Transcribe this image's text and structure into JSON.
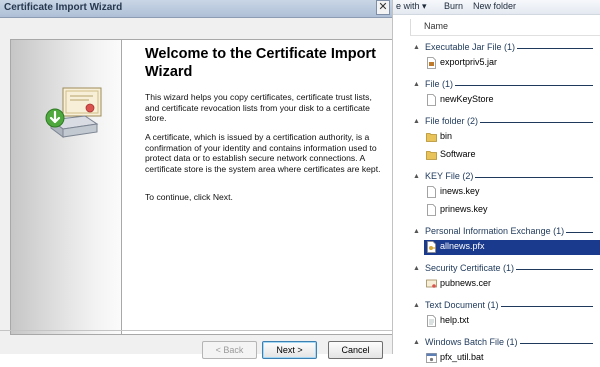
{
  "wizard": {
    "title": "Certificate Import Wizard",
    "close_glyph": "✕",
    "heading": "Welcome to the Certificate Import Wizard",
    "paragraph1": "This wizard helps you copy certificates, certificate trust lists, and certificate revocation lists from your disk to a certificate store.",
    "paragraph2": "A certificate, which is issued by a certification authority, is a confirmation of your identity and contains information used to protect data or to establish secure network connections. A certificate store is the system area where certificates are kept.",
    "paragraph3": "To continue, click Next.",
    "buttons": {
      "back": "< Back",
      "next": "Next >",
      "cancel": "Cancel"
    },
    "side_icon": "certificate-import-icon"
  },
  "explorer": {
    "toolbar": {
      "share": "e with",
      "share_arrow": "▾",
      "burn": "Burn",
      "new_folder": "New folder"
    },
    "column_name": "Name",
    "groups": [
      {
        "label": "Executable Jar File (1)",
        "items": [
          {
            "name": "exportpriv5.jar",
            "icon": "jar-file-icon"
          }
        ]
      },
      {
        "label": "File (1)",
        "items": [
          {
            "name": "newKeyStore",
            "icon": "file-icon"
          }
        ]
      },
      {
        "label": "File folder (2)",
        "items": [
          {
            "name": "bin",
            "icon": "folder-icon"
          },
          {
            "name": "Software",
            "icon": "folder-icon"
          }
        ]
      },
      {
        "label": "KEY File (2)",
        "items": [
          {
            "name": "inews.key",
            "icon": "file-icon"
          },
          {
            "name": "prinews.key",
            "icon": "file-icon"
          }
        ]
      },
      {
        "label": "Personal Information Exchange (1)",
        "items": [
          {
            "name": "allnews.pfx",
            "icon": "pfx-file-icon",
            "selected": true
          }
        ]
      },
      {
        "label": "Security Certificate (1)",
        "items": [
          {
            "name": "pubnews.cer",
            "icon": "certificate-file-icon"
          }
        ]
      },
      {
        "label": "Text Document (1)",
        "items": [
          {
            "name": "help.txt",
            "icon": "text-file-icon"
          }
        ]
      },
      {
        "label": "Windows Batch File (1)",
        "items": [
          {
            "name": "pfx_util.bat",
            "icon": "batch-file-icon"
          }
        ]
      }
    ],
    "colors": {
      "group_text": "#1e395b",
      "selection": "#1a3a8e",
      "folder": "#e8c35a"
    }
  }
}
